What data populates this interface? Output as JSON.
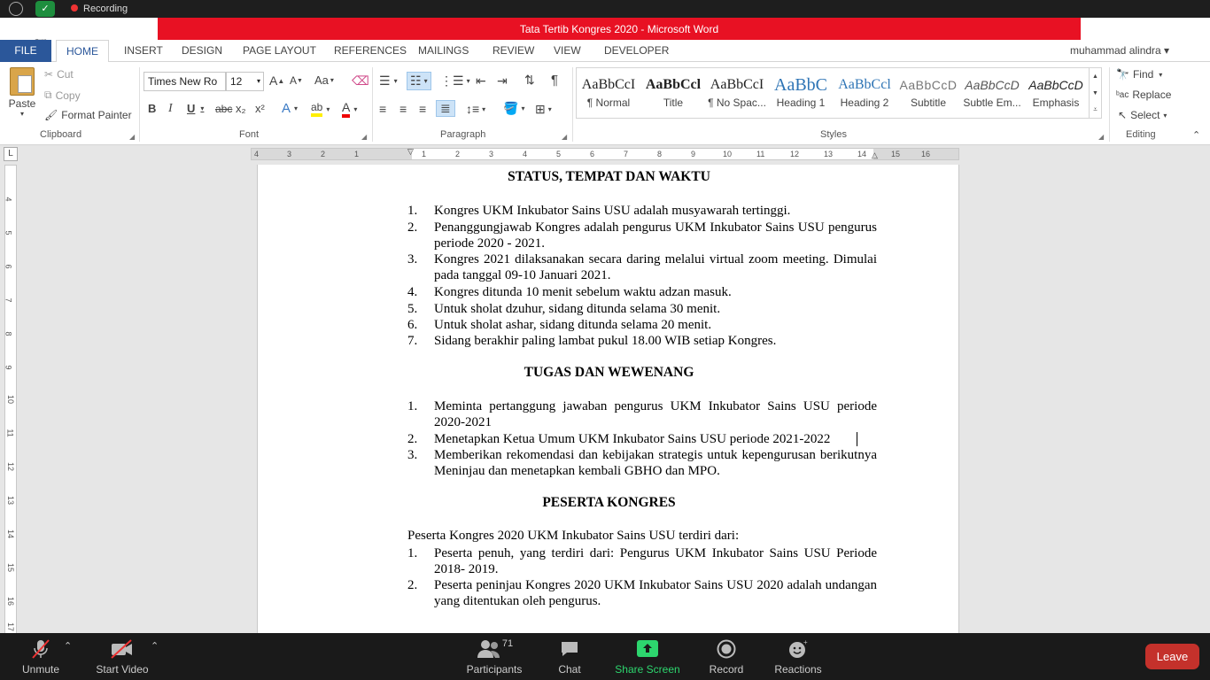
{
  "window": {
    "title": "Tata Tertib Kongres 2020 -  Microsoft Word",
    "recording": "Recording",
    "user": "muhammad alindra",
    "help": "?",
    "minimize": "−",
    "restore": "❐",
    "close": "✕",
    "ribbon_opts": "⧉"
  },
  "tabs": [
    "FILE",
    "HOME",
    "INSERT",
    "DESIGN",
    "PAGE LAYOUT",
    "REFERENCES",
    "MAILINGS",
    "REVIEW",
    "VIEW",
    "DEVELOPER"
  ],
  "clipboard": {
    "paste": "Paste",
    "cut": "Cut",
    "copy": "Copy",
    "format_painter": "Format Painter",
    "label": "Clipboard"
  },
  "font": {
    "name": "Times New Ro",
    "size": "12",
    "label": "Font",
    "bold": "B",
    "italic": "I",
    "underline": "U",
    "strike": "abc",
    "sub": "x₂",
    "sup": "x²",
    "case": "Aa",
    "grow": "A",
    "shrink": "A"
  },
  "paragraph": {
    "label": "Paragraph"
  },
  "styles": {
    "label": "Styles",
    "items": [
      {
        "preview": "AaBbCcI",
        "name": "¶ Normal"
      },
      {
        "preview": "AaBbCcl",
        "name": "Title"
      },
      {
        "preview": "AaBbCcI",
        "name": "¶ No Spac..."
      },
      {
        "preview": "AaBbC",
        "name": "Heading 1"
      },
      {
        "preview": "AaBbCcl",
        "name": "Heading 2"
      },
      {
        "preview": "AaBbCcD",
        "name": "Subtitle"
      },
      {
        "preview": "AaBbCcD",
        "name": "Subtle Em..."
      },
      {
        "preview": "AaBbCcD",
        "name": "Emphasis"
      }
    ]
  },
  "editing": {
    "find": "Find",
    "replace": "Replace",
    "select": "Select",
    "label": "Editing"
  },
  "ruler": {
    "h": [
      "4",
      "3",
      "2",
      "1",
      "1",
      "2",
      "3",
      "4",
      "5",
      "6",
      "7",
      "8",
      "9",
      "10",
      "11",
      "12",
      "13",
      "14",
      "15",
      "16"
    ],
    "v": [
      "4",
      "5",
      "6",
      "7",
      "8",
      "9",
      "10",
      "11",
      "12",
      "13",
      "14",
      "15",
      "16",
      "17"
    ],
    "tab": "L"
  },
  "doc": {
    "h1": "STATUS, TEMPAT DAN WAKTU",
    "list1": [
      {
        "n": "1.",
        "t": "Kongres UKM Inkubator Sains USU adalah musyawarah tertinggi."
      },
      {
        "n": "2.",
        "t": "Penanggungjawab Kongres adalah pengurus UKM Inkubator Sains USU pengurus periode 2020 - 2021."
      },
      {
        "n": "3.",
        "t": "Kongres 2021 dilaksanakan secara daring melalui virtual zoom meeting. Dimulai pada tanggal 09-10 Januari 2021."
      },
      {
        "n": "4.",
        "t": "Kongres ditunda 10 menit sebelum waktu adzan masuk."
      },
      {
        "n": "5.",
        "t": "Untuk sholat dzuhur, sidang ditunda selama 30 menit."
      },
      {
        "n": "6.",
        "t": "Untuk sholat ashar, sidang ditunda selama 20 menit."
      },
      {
        "n": "7.",
        "t": "Sidang berakhir paling lambat pukul 18.00 WIB setiap Kongres."
      }
    ],
    "h2": "TUGAS DAN WEWENANG",
    "list2": [
      {
        "n": "1.",
        "t": "Meminta pertanggung jawaban pengurus UKM Inkubator Sains USU periode 2020-2021"
      },
      {
        "n": "2.",
        "t": "Menetapkan Ketua Umum UKM Inkubator Sains USU periode 2021-2022"
      },
      {
        "n": "3.",
        "t": "Memberikan rekomendasi dan kebijakan strategis untuk kepengurusan berikutnya  Meninjau dan menetapkan kembali GBHO dan MPO."
      }
    ],
    "h3": "PESERTA KONGRES",
    "intro": "Peserta Kongres 2020 UKM Inkubator Sains USU terdiri dari:",
    "list3": [
      {
        "n": "1.",
        "t": "Peserta penuh, yang terdiri dari: Pengurus UKM Inkubator Sains USU Periode 2018- 2019."
      },
      {
        "n": "2.",
        "t": "Peserta peninjau Kongres 2020 UKM Inkubator Sains USU 2020 adalah undangan yang ditentukan oleh pengurus."
      }
    ]
  },
  "zoom": {
    "unmute": "Unmute",
    "video": "Start Video",
    "participants": "Participants",
    "count": "71",
    "chat": "Chat",
    "share": "Share Screen",
    "record": "Record",
    "reactions": "Reactions",
    "leave": "Leave"
  }
}
